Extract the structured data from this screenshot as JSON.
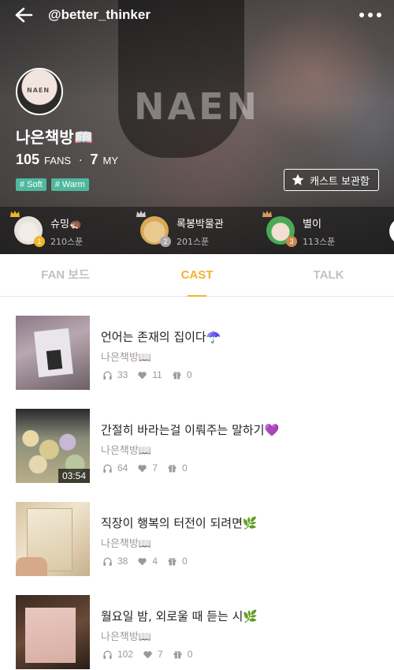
{
  "header": {
    "handle": "@better_thinker",
    "watermark": "NAEN",
    "avatar_text": "NAEN",
    "name": "나은책방📖",
    "fans_count": "105",
    "fans_label": "FANS",
    "separator": "·",
    "my_count": "7",
    "my_label": "MY",
    "tags": [
      "# Soft",
      "# Warm"
    ],
    "archive_label": "캐스트 보관함"
  },
  "ranking": [
    {
      "rank": "1",
      "name": "슈밍🦔",
      "count": "210스푼"
    },
    {
      "rank": "2",
      "name": "록봉박물관",
      "count": "201스푼"
    },
    {
      "rank": "3",
      "name": "별이",
      "count": "113스푼"
    }
  ],
  "tabs": [
    {
      "label": "FAN 보드",
      "active": false
    },
    {
      "label": "CAST",
      "active": true
    },
    {
      "label": "TALK",
      "active": false
    }
  ],
  "casts": [
    {
      "title": "언어는 존재의 집이다☂️",
      "author": "나은책방📖",
      "listens": "33",
      "likes": "11",
      "gifts": "0",
      "duration": ""
    },
    {
      "title": "간절히 바라는걸 이뤄주는 말하기💜",
      "author": "나은책방📖",
      "listens": "64",
      "likes": "7",
      "gifts": "0",
      "duration": "03:54"
    },
    {
      "title": "직장이 행복의 터전이 되려면🌿",
      "author": "나은책방📖",
      "listens": "38",
      "likes": "4",
      "gifts": "0",
      "duration": ""
    },
    {
      "title": "월요일 밤, 외로울 때 듣는 시🌿",
      "author": "나은책방📖",
      "listens": "102",
      "likes": "7",
      "gifts": "0",
      "duration": ""
    }
  ],
  "colors": {
    "accent": "#f4b12c",
    "tag": "#4fb89e",
    "rank1_badge": "#f0b52a",
    "rank2_badge": "#a8a8a8",
    "rank3_badge": "#c98a4a"
  },
  "icons": {
    "back": "arrow-left-icon",
    "more": "more-dots-icon",
    "archive": "star-icon",
    "crown": "crown-icon",
    "listens": "headphones-icon",
    "likes": "heart-icon",
    "gifts": "gift-icon"
  }
}
